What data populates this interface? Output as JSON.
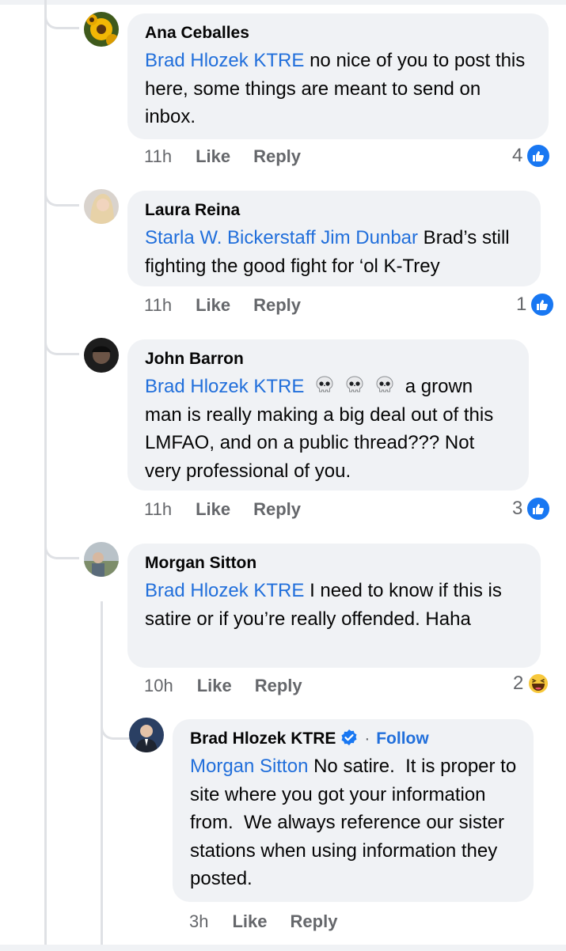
{
  "comments": [
    {
      "author": "Ana Ceballes",
      "mentions": [
        "Brad Hlozek KTRE"
      ],
      "body": " no nice of you to post this here, some things are meant to send on inbox.",
      "time": "11h",
      "like_label": "Like",
      "reply_label": "Reply",
      "reaction_count": "4",
      "reaction_icon": "like-icon"
    },
    {
      "author": "Laura Reina",
      "mentions": [
        "Starla W. Bickerstaff",
        "Jim Dunbar"
      ],
      "body": " Brad’s still fighting the good fight for ‘ol K-Trey",
      "time": "11h",
      "like_label": "Like",
      "reply_label": "Reply",
      "reaction_count": "1",
      "reaction_icon": "like-icon"
    },
    {
      "author": "John Barron",
      "mentions": [
        "Brad Hlozek KTRE"
      ],
      "emoji": "skull-icon x3",
      "body": " a grown man is really making a big deal out of this LMFAO, and on a public thread??? Not very professional of you.",
      "time": "11h",
      "like_label": "Like",
      "reply_label": "Reply",
      "reaction_count": "3",
      "reaction_icon": "like-icon"
    },
    {
      "author": "Morgan Sitton",
      "mentions": [
        "Brad Hlozek KTRE"
      ],
      "body": " I need to know if this is satire or if you’re really offended. Haha",
      "time": "10h",
      "like_label": "Like",
      "reply_label": "Reply",
      "reaction_count": "2",
      "reaction_icon": "haha-icon"
    }
  ],
  "reply": {
    "author": "Brad Hlozek KTRE",
    "follow_label": "Follow",
    "mentions": [
      "Morgan Sitton"
    ],
    "body": " No satire.  It is proper to site where you got your information from.  We always reference our sister stations when using information they posted.",
    "time": "3h",
    "like_label": "Like",
    "reply_label": "Reply"
  },
  "colors": {
    "link": "#216fdb",
    "bubble": "#f0f2f5",
    "meta": "#65676b",
    "like_blue": "#1877f2"
  }
}
